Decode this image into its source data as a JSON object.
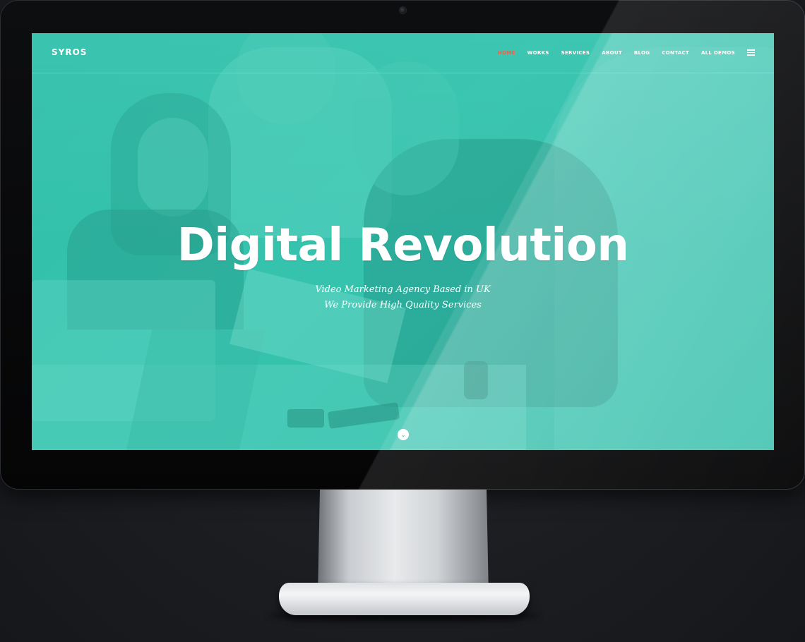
{
  "site": {
    "logo": "SYROS",
    "nav": [
      {
        "label": "HOME",
        "active": true
      },
      {
        "label": "WORKS",
        "active": false
      },
      {
        "label": "SERVICES",
        "active": false
      },
      {
        "label": "ABOUT",
        "active": false
      },
      {
        "label": "BLOG",
        "active": false
      },
      {
        "label": "CONTACT",
        "active": false
      },
      {
        "label": "ALL DEMOS",
        "active": false
      }
    ],
    "menu_icon": "hamburger-menu-icon",
    "scroll_icon": "chevron-down-icon"
  },
  "hero": {
    "title": "Digital Revolution",
    "subtitle_line1": "Video Marketing Agency Based in UK",
    "subtitle_line2": "We Provide High Quality Services"
  },
  "colors": {
    "accent_teal": "#34c4ae",
    "active_nav": "#e8654d",
    "text": "#ffffff",
    "background": "#1c1e22"
  }
}
